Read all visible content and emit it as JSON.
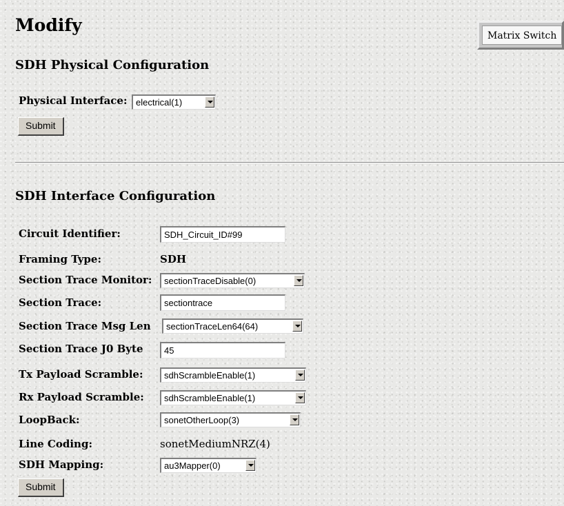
{
  "page": {
    "title": "Modify",
    "matrix_switch_label": "Matrix Switch"
  },
  "physical": {
    "heading": "SDH Physical Configuration",
    "interface_label": "Physical Interface:",
    "interface_value": "electrical(1)",
    "submit_label": "Submit"
  },
  "interface": {
    "heading": "SDH Interface Configuration",
    "circuit_id": {
      "label": "Circuit Identifier:",
      "value": "SDH_Circuit_ID#99"
    },
    "framing_type": {
      "label": "Framing Type:",
      "value": "SDH"
    },
    "section_trace_monitor": {
      "label": "Section Trace Monitor:",
      "value": "sectionTraceDisable(0)"
    },
    "section_trace": {
      "label": "Section Trace:",
      "value": "sectiontrace"
    },
    "section_trace_msg_len": {
      "label": "Section Trace Msg Len",
      "value": "sectionTraceLen64(64)"
    },
    "section_trace_j0": {
      "label": "Section Trace J0 Byte",
      "value": "45"
    },
    "tx_payload_scramble": {
      "label": "Tx Payload Scramble:",
      "value": "sdhScrambleEnable(1)"
    },
    "rx_payload_scramble": {
      "label": "Rx Payload Scramble:",
      "value": "sdhScrambleEnable(1)"
    },
    "loopback": {
      "label": "LoopBack:",
      "value": "sonetOtherLoop(3)"
    },
    "line_coding": {
      "label": "Line Coding:",
      "value": "sonetMediumNRZ(4)"
    },
    "sdh_mapping": {
      "label": "SDH Mapping:",
      "value": "au3Mapper(0)"
    },
    "submit_label": "Submit"
  }
}
